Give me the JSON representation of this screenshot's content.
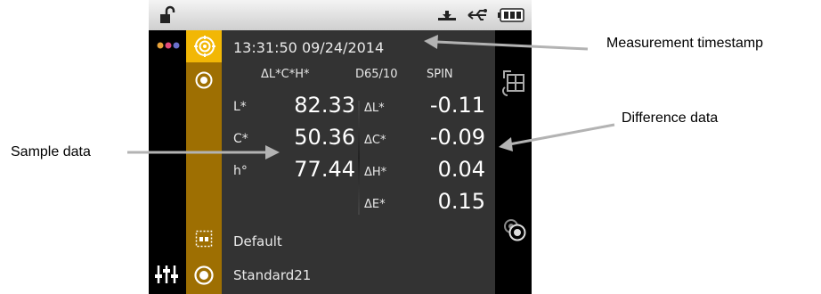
{
  "status_bar": {
    "icons": [
      "lock-open-icon",
      "usb-stick-icon",
      "usb-icon",
      "battery-icon"
    ]
  },
  "device": {
    "timestamp": "13:31:50 09/24/2014",
    "header": {
      "scale": "ΔL*C*H*",
      "illuminant": "D65/10",
      "mode": "SPIN"
    },
    "sample": [
      {
        "label": "L*",
        "value": "82.33"
      },
      {
        "label": "C*",
        "value": "50.36"
      },
      {
        "label": "h°",
        "value": "77.44"
      }
    ],
    "difference": [
      {
        "label": "ΔL*",
        "value": "-0.11"
      },
      {
        "label": "ΔC*",
        "value": "-0.09"
      },
      {
        "label": "ΔH*",
        "value": "0.04"
      },
      {
        "label": "ΔE*",
        "value": "0.15"
      }
    ],
    "tolerance_label": "Default",
    "standard_label": "Standard21"
  },
  "callouts": {
    "timestamp": "Measurement timestamp",
    "difference": "Difference data",
    "sample": "Sample data"
  },
  "colors": {
    "gold_strip": "#9e6f02",
    "gold_active": "#f2b705",
    "panel": "#333333",
    "arrow": "#b3b3b3"
  }
}
